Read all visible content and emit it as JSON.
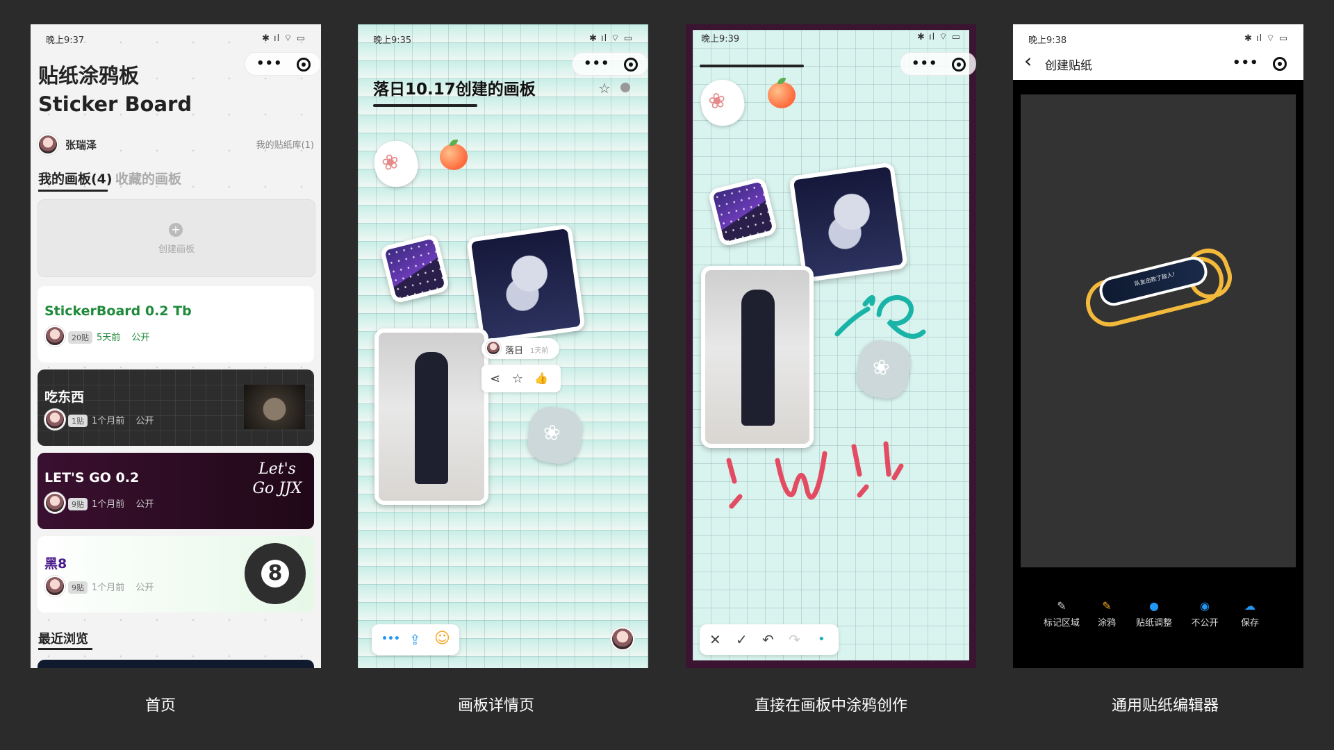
{
  "captions": [
    "首页",
    "画板详情页",
    "直接在画板中涂鸦创作",
    "通用贴纸编辑器"
  ],
  "home": {
    "time": "晚上9:37",
    "status_icons": "✱ ıl ⌔ ▭",
    "title_line1": "贴纸涂鸦板",
    "title_line2": "Sticker Board",
    "user_name": "张瑞泽",
    "library_link": "我的贴纸库(1)",
    "tab_my": "我的画板(4)",
    "tab_fav": "收藏的画板",
    "create_label": "创建画板",
    "create_icon": "+",
    "recent_label": "最近浏览",
    "boards": [
      {
        "title": "StickerBoard 0.2 Tb",
        "count": "20贴",
        "time": "5天前",
        "visibility": "公开"
      },
      {
        "title": "吃东西",
        "count": "1贴",
        "time": "1个月前",
        "visibility": "公开"
      },
      {
        "title": "LET'S GO 0.2",
        "count": "9贴",
        "time": "1个月前",
        "visibility": "公开",
        "doodle": "Let's Go JJX"
      },
      {
        "title": "黑8",
        "count": "9贴",
        "time": "1个月前",
        "visibility": "公开",
        "ball": "8"
      }
    ]
  },
  "detail": {
    "time": "晚上9:35",
    "status_icons": "✱ ıl ⌔ ▭",
    "board_title": "落日10.17创建的画板",
    "star_icon": "☆",
    "popup_user": "落日",
    "popup_time": "1天前",
    "toolbar_more": "•••",
    "toolbar_share": "⇪",
    "toolbar_emoji": "☺",
    "popup_share": "⋖",
    "popup_star": "☆",
    "popup_like": "👍"
  },
  "doodle": {
    "time": "晚上9:39",
    "status_icons": "✱ ıl ⌔ ▭",
    "close_icon": "✕",
    "check_icon": "✓",
    "undo_icon": "↶",
    "redo_icon": "↷",
    "dot_icon": "•"
  },
  "editor": {
    "time": "晚上9:38",
    "status_icons": "✱ ıl ⌔ ▭",
    "back_icon": "‹",
    "title": "创建贴纸",
    "sticker_text": "队友击败了敌人!",
    "tools": [
      {
        "label": "标记区域",
        "icon": "✎",
        "color": "#cccccc"
      },
      {
        "label": "涂鸦",
        "icon": "✎",
        "color": "#f5a623"
      },
      {
        "label": "贴纸调整",
        "icon": "●",
        "color": "#2196f3"
      },
      {
        "label": "不公开",
        "icon": "◉",
        "color": "#2196f3"
      },
      {
        "label": "保存",
        "icon": "☁",
        "color": "#2196f3"
      }
    ]
  }
}
